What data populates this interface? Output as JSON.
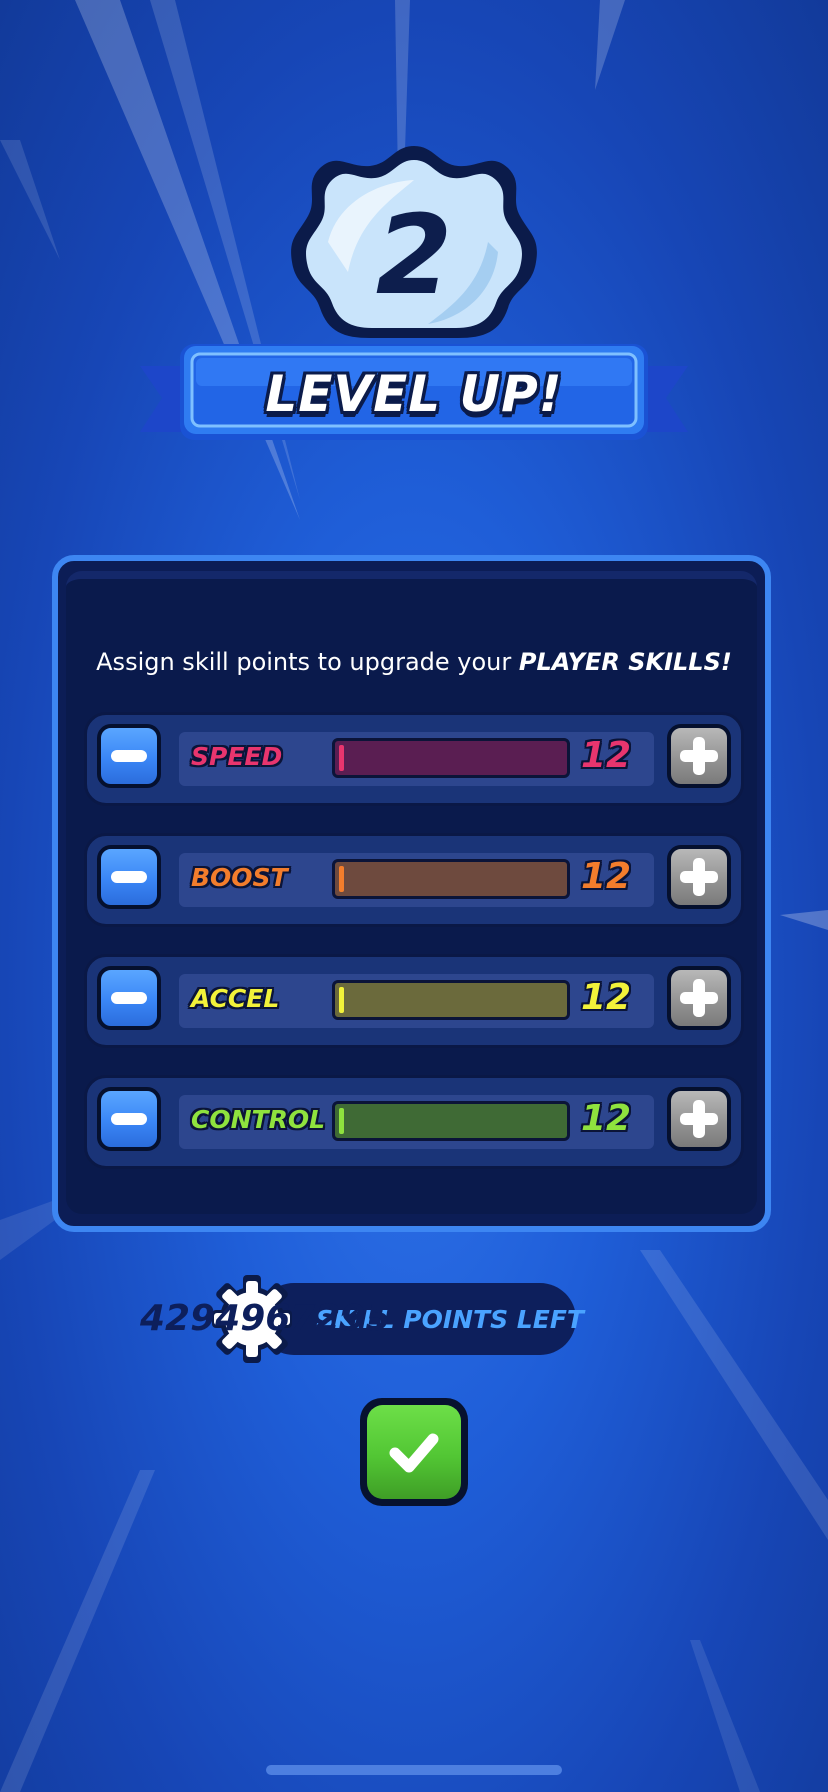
{
  "level": {
    "number": "2",
    "title": "LEVEL UP!"
  },
  "panel": {
    "instructions_prefix": "Assign skill points to upgrade your ",
    "instructions_emphasis": "PLAYER SKILLS!"
  },
  "skills": [
    {
      "label": "SPEED",
      "value": "12",
      "color": "#e8356e",
      "bar_color": "#5a1e52",
      "level_fraction": 0.02
    },
    {
      "label": "BOOST",
      "value": "12",
      "color": "#f37d2c",
      "bar_color": "#6e4a3e",
      "level_fraction": 0.02
    },
    {
      "label": "ACCEL",
      "value": "12",
      "color": "#f2f23a",
      "bar_color": "#6b6a3c",
      "level_fraction": 0.02
    },
    {
      "label": "CONTROL",
      "value": "12",
      "color": "#8fe23e",
      "bar_color": "#3f6a35",
      "level_fraction": 0.02
    }
  ],
  "skill_points": {
    "value": "4294967295",
    "label": "SKILL POINTS LEFT"
  },
  "icons": {
    "minus": "minus-icon",
    "plus": "plus-icon",
    "gear": "gear-icon",
    "check": "checkmark-icon"
  }
}
